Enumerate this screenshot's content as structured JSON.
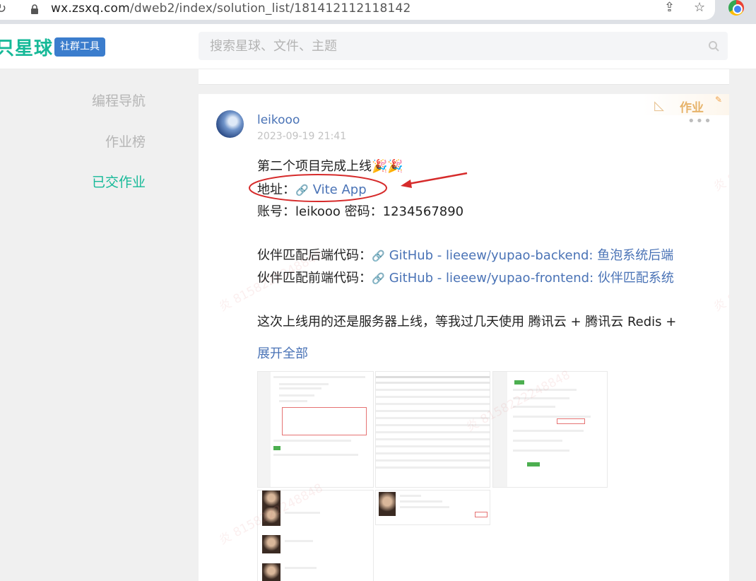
{
  "browser": {
    "url_host": "wx.zsxq.com",
    "url_path": "/dweb2/index/solution_list/181412112118142"
  },
  "header": {
    "logo": "只星球",
    "badge": "社群工具",
    "search_placeholder": "搜索星球、文件、主题"
  },
  "nav": {
    "items": [
      {
        "label": "编程导航",
        "active": false
      },
      {
        "label": "作业榜",
        "active": false
      },
      {
        "label": "已交作业",
        "active": true
      }
    ]
  },
  "post": {
    "corner_label": "作业",
    "author": "leikooo",
    "time": "2023-09-19 21:41",
    "more": "•••",
    "line1": "第二个项目完成上线🎉🎉",
    "address_label": "地址：",
    "address_link": "Vite App",
    "account_line": "账号：leikooo  密码：1234567890",
    "backend_label": "伙伴匹配后端代码：",
    "backend_link": "GitHub - lieeew/yupao-backend: 鱼泡系统后端",
    "frontend_label": "伙伴匹配前端代码：",
    "frontend_link": "GitHub - lieeew/yupao-frontend: 伙伴匹配系统",
    "deploy_line": "这次上线用的还是服务器上线，等我过几天使用 腾讯云 + 腾讯云 Redis +",
    "expand": "展开全部"
  },
  "watermark": "炎 8158222248848"
}
